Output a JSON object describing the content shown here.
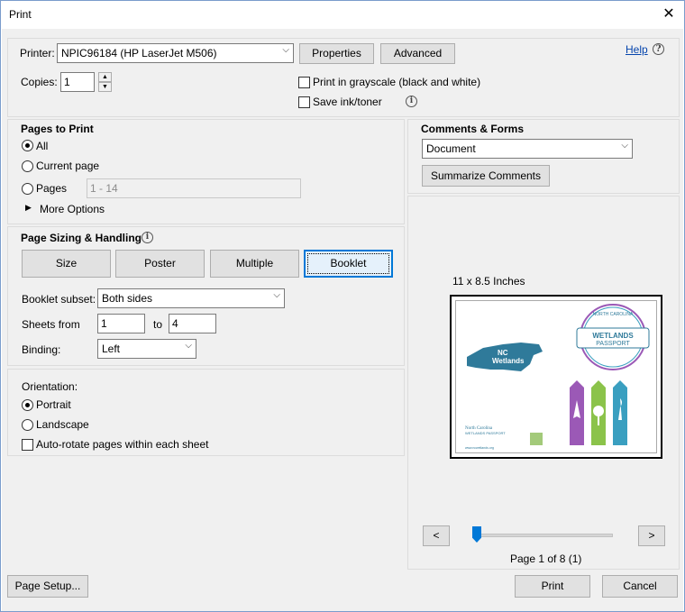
{
  "window": {
    "title": "Print",
    "close_glyph": "✕"
  },
  "printer": {
    "label": "Printer:",
    "selected": "NPIC96184 (HP LaserJet M506)",
    "properties_label": "Properties",
    "advanced_label": "Advanced",
    "help_label": "Help",
    "copies_label": "Copies:",
    "copies_value": "1",
    "grayscale_label": "Print in grayscale (black and white)",
    "grayscale_checked": false,
    "save_ink_label": "Save ink/toner",
    "save_ink_checked": false
  },
  "pages_to_print": {
    "heading": "Pages to Print",
    "all_label": "All",
    "current_label": "Current page",
    "pages_label": "Pages",
    "pages_value": "1 - 14",
    "more_options_label": "More Options",
    "selected": "all"
  },
  "sizing": {
    "heading": "Page Sizing & Handling",
    "buttons": [
      "Size",
      "Poster",
      "Multiple",
      "Booklet"
    ],
    "selected": "Booklet",
    "booklet_subset_label": "Booklet subset:",
    "booklet_subset_value": "Both sides",
    "sheets_from_label": "Sheets from",
    "sheets_from_value": "1",
    "sheets_to_label": "to",
    "sheets_to_value": "4",
    "binding_label": "Binding:",
    "binding_value": "Left"
  },
  "orientation": {
    "heading": "Orientation:",
    "portrait_label": "Portrait",
    "landscape_label": "Landscape",
    "selected": "portrait",
    "autorotate_label": "Auto-rotate pages within each sheet",
    "autorotate_checked": false
  },
  "comments_forms": {
    "heading": "Comments & Forms",
    "selected": "Document",
    "summarize_label": "Summarize Comments"
  },
  "preview": {
    "paper_size": "11 x 8.5 Inches",
    "page_status": "Page 1 of 8 (1)",
    "prev_label": "<",
    "next_label": ">",
    "slider_position": 0,
    "doc_text": {
      "map_label_line1": "NC",
      "map_label_line2": "Wetlands",
      "badge_top": "NORTH CAROLINA",
      "badge_main": "WETLANDS",
      "badge_sub": "PASSPORT",
      "footer_line1": "North Carolina",
      "footer_line2": "WETLANDS PASSPORT",
      "footer_url": "www.ncwetlands.org"
    },
    "colors": {
      "nc_blue": "#2f7a9a",
      "purple": "#9b59b6",
      "green": "#8bc34a",
      "teal": "#3a9fc0"
    }
  },
  "footer": {
    "page_setup_label": "Page Setup...",
    "print_label": "Print",
    "cancel_label": "Cancel"
  }
}
